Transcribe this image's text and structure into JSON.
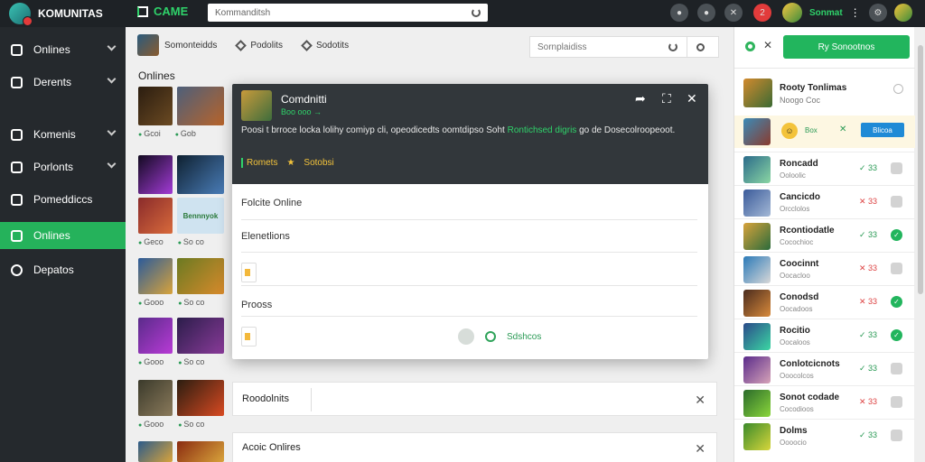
{
  "app": {
    "brand": "KOMUNITAS",
    "game_title": "CAME"
  },
  "top": {
    "search_value": "Kommanditsh",
    "user_name": "Sonmat",
    "notification_count": "2"
  },
  "sidebar": {
    "items": [
      {
        "label": "Onlines",
        "has_chevron": true
      },
      {
        "label": "Derents",
        "has_chevron": true
      },
      {
        "label": "Komenis",
        "has_chevron": true
      },
      {
        "label": "Porlonts",
        "has_chevron": true
      },
      {
        "label": "Pomeddiccs",
        "has_chevron": false
      },
      {
        "label": "Onlines",
        "has_chevron": false,
        "active": true
      },
      {
        "label": "Depatos",
        "has_chevron": false
      }
    ]
  },
  "main": {
    "tabs": [
      "Somonteidds",
      "Podolits",
      "Sodotits"
    ],
    "search_placeholder": "Sornplaidiss",
    "section_title": "Onlines",
    "games": [
      {
        "meta": [
          "Gcoi",
          "Gob"
        ],
        "tag": ""
      },
      {
        "meta": [
          "",
          ""
        ],
        "tag": ""
      },
      {
        "meta": [
          "Geco",
          "So co"
        ],
        "tag": "Bennnyok"
      },
      {
        "meta": [
          "Gooo",
          "So co"
        ],
        "tag": ""
      },
      {
        "meta": [
          "Gooo",
          "So co"
        ],
        "tag": ""
      },
      {
        "meta": [
          "Gooo",
          "So co"
        ],
        "tag": ""
      },
      {
        "meta": [
          "",
          ""
        ],
        "tag": ""
      }
    ],
    "panels": [
      {
        "label": "Roodolnits"
      },
      {
        "label": "Acoic Onlires"
      }
    ]
  },
  "modal": {
    "title": "Comdnitti",
    "subtitle": "Boo ooo →",
    "description": "Poosi t brroce locka lolihy comiyp cli, opeodicedts oomtdipso Soht",
    "description_link": "Rontichsed digris",
    "description_tail": "go de Dosecolroopeoot.",
    "tag_a": "Romets",
    "tag_b": "Sotobsi",
    "rows": [
      "Folcite Online",
      "Elenetlions",
      "Prooss"
    ],
    "status": "Sdshcos"
  },
  "right": {
    "cta_label": "Ry Sonootnos",
    "featured": {
      "title": "Rooty Tonlimas",
      "sub": "Noogo Coc"
    },
    "highlight": {
      "tag": "Box",
      "button": "Blicoa"
    },
    "players": [
      {
        "name": "Roncadd",
        "status": "Ooloolic",
        "mark": "✓ 33",
        "ok": true,
        "checked": false
      },
      {
        "name": "Cancicdo",
        "status": "Orcclolos",
        "mark": "✕ 33",
        "ok": false,
        "checked": false
      },
      {
        "name": "Rcontiodatle",
        "status": "Cocochioc",
        "mark": "✓ 33",
        "ok": true,
        "checked": true
      },
      {
        "name": "Coocinnt",
        "status": "Oocacloo",
        "mark": "✕ 33",
        "ok": false,
        "checked": false
      },
      {
        "name": "Conodsd",
        "status": "Oocadoos",
        "mark": "✕ 33",
        "ok": false,
        "checked": true
      },
      {
        "name": "Rocitio",
        "status": "Oocaloos",
        "mark": "✓ 33",
        "ok": true,
        "checked": true
      },
      {
        "name": "Conlotcicnots",
        "status": "Ooocolcos",
        "mark": "✓ 33",
        "ok": true,
        "checked": false
      },
      {
        "name": "Sonot codade",
        "status": "Cocodioos",
        "mark": "✕ 33",
        "ok": false,
        "checked": false
      },
      {
        "name": "Dolms",
        "status": "Oooocio",
        "mark": "✓ 33",
        "ok": true,
        "checked": false
      }
    ]
  },
  "colors": {
    "accent": "#22b55d",
    "topbar": "#1e2226",
    "sidebar": "#25292d",
    "modal_header": "#32373b"
  },
  "icons": {
    "sidebar": [
      "globe-icon",
      "folder-icon",
      "monitor-icon",
      "group-icon",
      "bookmark-icon",
      "chat-icon",
      "settings-icon"
    ]
  }
}
